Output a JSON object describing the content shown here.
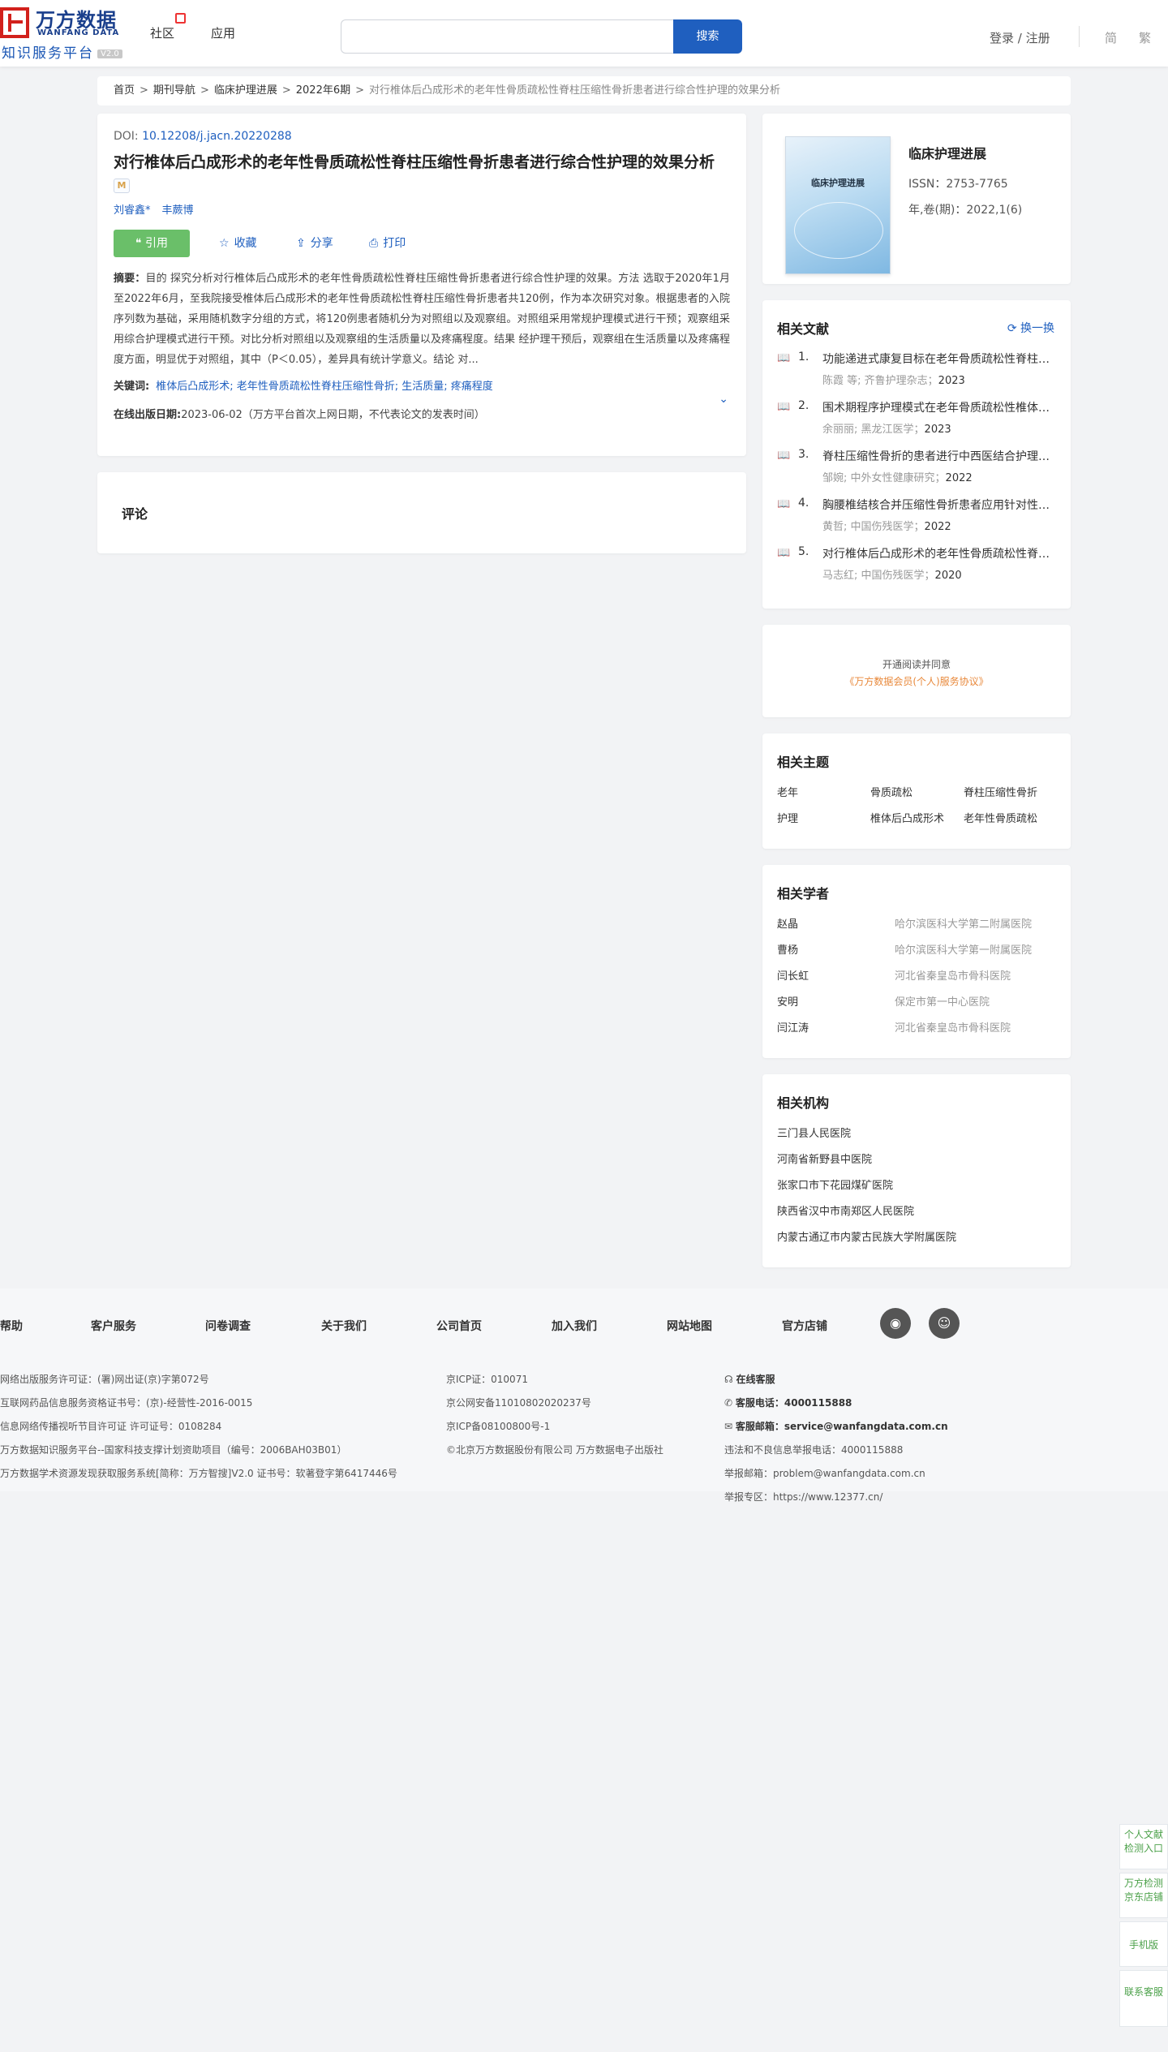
{
  "header": {
    "logo_cn": "万方数据",
    "logo_en": "WANFANG DATA",
    "logo_sub": "知识服务平台",
    "logo_ver": "V2.0",
    "nav": [
      "社区",
      "应用"
    ],
    "search_placeholder": "",
    "search_button": "搜索",
    "login": "登录 / 注册",
    "lang_simplified": "简",
    "lang_traditional": "繁"
  },
  "breadcrumb": [
    "首页",
    "期刊导航",
    "临床护理进展",
    "2022年6期",
    "对行椎体后凸成形术的老年性骨质疏松性脊柱压缩性骨折患者进行综合性护理的效果分析"
  ],
  "article": {
    "doi_label": "DOI:",
    "doi": "10.12208/j.jacn.20220288",
    "title": "对行椎体后凸成形术的老年性骨质疏松性脊柱压缩性骨折患者进行综合性护理的效果分析",
    "badge": "M",
    "authors": [
      "刘睿鑫*",
      "丰蕨博"
    ],
    "cite": "引用",
    "favorite": "收藏",
    "share": "分享",
    "print": "打印",
    "abstract_label": "摘要：",
    "abstract": "目的  探究分析对行椎体后凸成形术的老年性骨质疏松性脊柱压缩性骨折患者进行综合性护理的效果。方法 选取于2020年1月至2022年6月，至我院接受椎体后凸成形术的老年性骨质疏松性脊柱压缩性骨折患者共120例，作为本次研究对象。根据患者的入院序列数为基础，采用随机数字分组的方式，将120例患者随机分为对照组以及观察组。对照组采用常规护理模式进行干预；观察组采用综合护理模式进行干预。对比分析对照组以及观察组的生活质量以及疼痛程度。结果 经护理干预后，观察组在生活质量以及疼痛程度方面，明显优于对照组，其中（P＜0.05），差异具有统计学意义。结论 对...",
    "keywords_label": "关键词:",
    "keywords": [
      "椎体后凸成形术;",
      "老年性骨质疏松性脊柱压缩性骨折;",
      "生活质量;",
      "疼痛程度"
    ],
    "pubdate_label": "在线出版日期:",
    "pubdate": "2023-06-02",
    "pubdate_note": "（万方平台首次上网日期，不代表论文的发表时间）"
  },
  "comments": {
    "title": "评论"
  },
  "journal": {
    "cover_title": "临床护理进展",
    "name": "临床护理进展",
    "issn": "ISSN：2753-7765",
    "volume": "年,卷(期)：2022,1(6)"
  },
  "related": {
    "title": "相关文献",
    "swap": "换一换",
    "items": [
      {
        "num": "1.",
        "title": "功能递进式康复目标在老年骨质疏松性脊柱压缩性骨折患者中的应用",
        "authors": "陈霞  等;",
        "source": "齐鲁护理杂志；",
        "year": "2023"
      },
      {
        "num": "2.",
        "title": "围术期程序护理模式在老年骨质疏松性椎体压缩性骨折患者中的应用",
        "authors": "余丽丽;",
        "source": "黑龙江医学；",
        "year": "2023"
      },
      {
        "num": "3.",
        "title": "脊柱压缩性骨折的患者进行中西医结合护理的效果分析",
        "authors": "邹婉;",
        "source": "中外女性健康研究；",
        "year": "2022"
      },
      {
        "num": "4.",
        "title": "胸腰椎结核合并压缩性骨折患者应用针对性护理的效果",
        "authors": "黄哲;",
        "source": "中国伤残医学；",
        "year": "2022"
      },
      {
        "num": "5.",
        "title": "对行椎体后凸成形术的老年性骨质疏松性脊柱压缩性骨折患者的护理",
        "authors": "马志红;",
        "source": "中国伤残医学；",
        "year": "2020"
      }
    ]
  },
  "agreement": {
    "line1": "开通阅读并同意",
    "line2": "《万方数据会员(个人)服务协议》"
  },
  "topics": {
    "title": "相关主题",
    "items": [
      "老年",
      "骨质疏松",
      "脊柱压缩性骨折",
      "护理",
      "椎体后凸成形术",
      "老年性骨质疏松"
    ]
  },
  "scholars": {
    "title": "相关学者",
    "items": [
      {
        "name": "赵晶",
        "org": "哈尔滨医科大学第二附属医院"
      },
      {
        "name": "曹杨",
        "org": "哈尔滨医科大学第一附属医院"
      },
      {
        "name": "闫长虹",
        "org": "河北省秦皇岛市骨科医院"
      },
      {
        "name": "安明",
        "org": "保定市第一中心医院"
      },
      {
        "name": "闫江涛",
        "org": "河北省秦皇岛市骨科医院"
      }
    ]
  },
  "institutions": {
    "title": "相关机构",
    "items": [
      "三门县人民医院",
      "河南省新野县中医院",
      "张家口市下花园煤矿医院",
      "陕西省汉中市南郑区人民医院",
      "内蒙古通辽市内蒙古民族大学附属医院"
    ]
  },
  "footer": {
    "nav": [
      "帮助",
      "客户服务",
      "问卷调查",
      "关于我们",
      "公司首页",
      "加入我们",
      "网站地图",
      "官方店铺"
    ],
    "col1": [
      "网络出版服务许可证：(署)网出证(京)字第072号",
      "互联网药品信息服务资格证书号：(京)-经营性-2016-0015",
      "信息网络传播视听节目许可证 许可证号：0108284",
      "万方数据知识服务平台--国家科技支撑计划资助项目（编号：2006BAH03B01）",
      "万方数据学术资源发现获取服务系统[简称：万方智搜]V2.0 证书号：软著登字第6417446号"
    ],
    "col2": [
      "京ICP证：010071",
      "京公网安备11010802020237号",
      "京ICP备08100800号-1",
      "©北京万方数据股份有限公司 万方数据电子出版社"
    ],
    "col3": {
      "online": "在线客服",
      "phone_label": "客服电话：",
      "phone": "4000115888",
      "email_label": "客服邮箱：",
      "email": "service@wanfangdata.com.cn",
      "report_phone": "违法和不良信息举报电话：4000115888",
      "report_email": "举报邮箱：problem@wanfangdata.com.cn",
      "report_site": "举报专区：https://www.12377.cn/"
    }
  },
  "side": {
    "check": "个人文献检测入口",
    "jd": "万方检测京东店铺",
    "mobile": "手机版",
    "contact": "联系客服"
  }
}
